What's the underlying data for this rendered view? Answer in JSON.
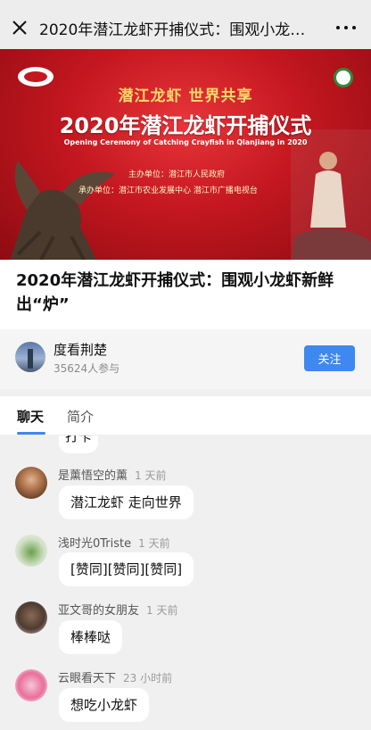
{
  "window": {
    "title": "2020年潜江龙虾开捕仪式：围观小龙…"
  },
  "banner": {
    "slogan": "潜江龙虾 世界共享",
    "title": "2020年潜江龙虾开捕仪式",
    "subtitle_en": "Opening Ceremony of Catching Crayfish in Qianjiang in 2020",
    "organizer": "主办单位：潜江市人民政府",
    "co_organizer": "承办单位：潜江市农业发展中心 潜江市广播电视台"
  },
  "article": {
    "title": "2020年潜江龙虾开捕仪式：围观小龙虾新鲜出“炉”"
  },
  "channel": {
    "name": "度看荆楚",
    "participants": "35624人参与",
    "follow_label": "关注"
  },
  "tabs": [
    {
      "label": "聊天",
      "active": true
    },
    {
      "label": "简介",
      "active": false
    }
  ],
  "chat": {
    "partial_message": "打卡",
    "messages": [
      {
        "user": "是薰悟空的薰",
        "time": "1 天前",
        "text": "潜江龙虾 走向世界"
      },
      {
        "user": "浅时光0Triste",
        "time": "1 天前",
        "text": "[赞同][赞同][赞同]"
      },
      {
        "user": "亚文哥的女朋友",
        "time": "1 天前",
        "text": "棒棒哒"
      },
      {
        "user": "云眼看天下",
        "time": "23 小时前",
        "text": "想吃小龙虾"
      }
    ]
  },
  "colors": {
    "accent": "#3f88f0",
    "banner_red": "#c41720",
    "slogan_gold": "#ffd86b"
  }
}
